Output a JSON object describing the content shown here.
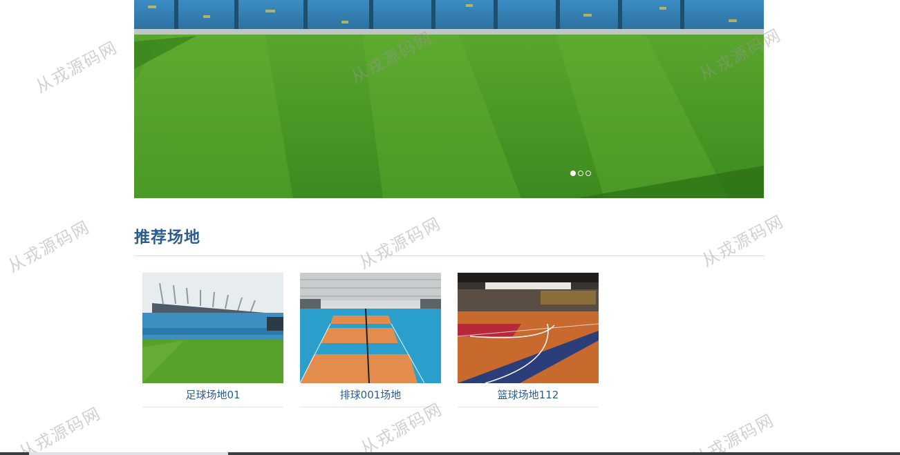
{
  "carousel": {
    "slide_count": 3,
    "active_index": 0,
    "slides": [
      "stadium-grass-slide",
      "slide-2",
      "slide-3"
    ]
  },
  "section": {
    "title": "推荐场地"
  },
  "venues": [
    {
      "name": "足球场地01",
      "image": "football-stadium-photo"
    },
    {
      "name": "排球001场地",
      "image": "volleyball-court-photo"
    },
    {
      "name": "篮球场地112",
      "image": "basketball-court-photo"
    }
  ],
  "watermark": {
    "text": "从戎源码网"
  },
  "colors": {
    "accent": "#2b5d8f",
    "divider": "#dcdcdc",
    "grass": "#4e9a2a"
  }
}
